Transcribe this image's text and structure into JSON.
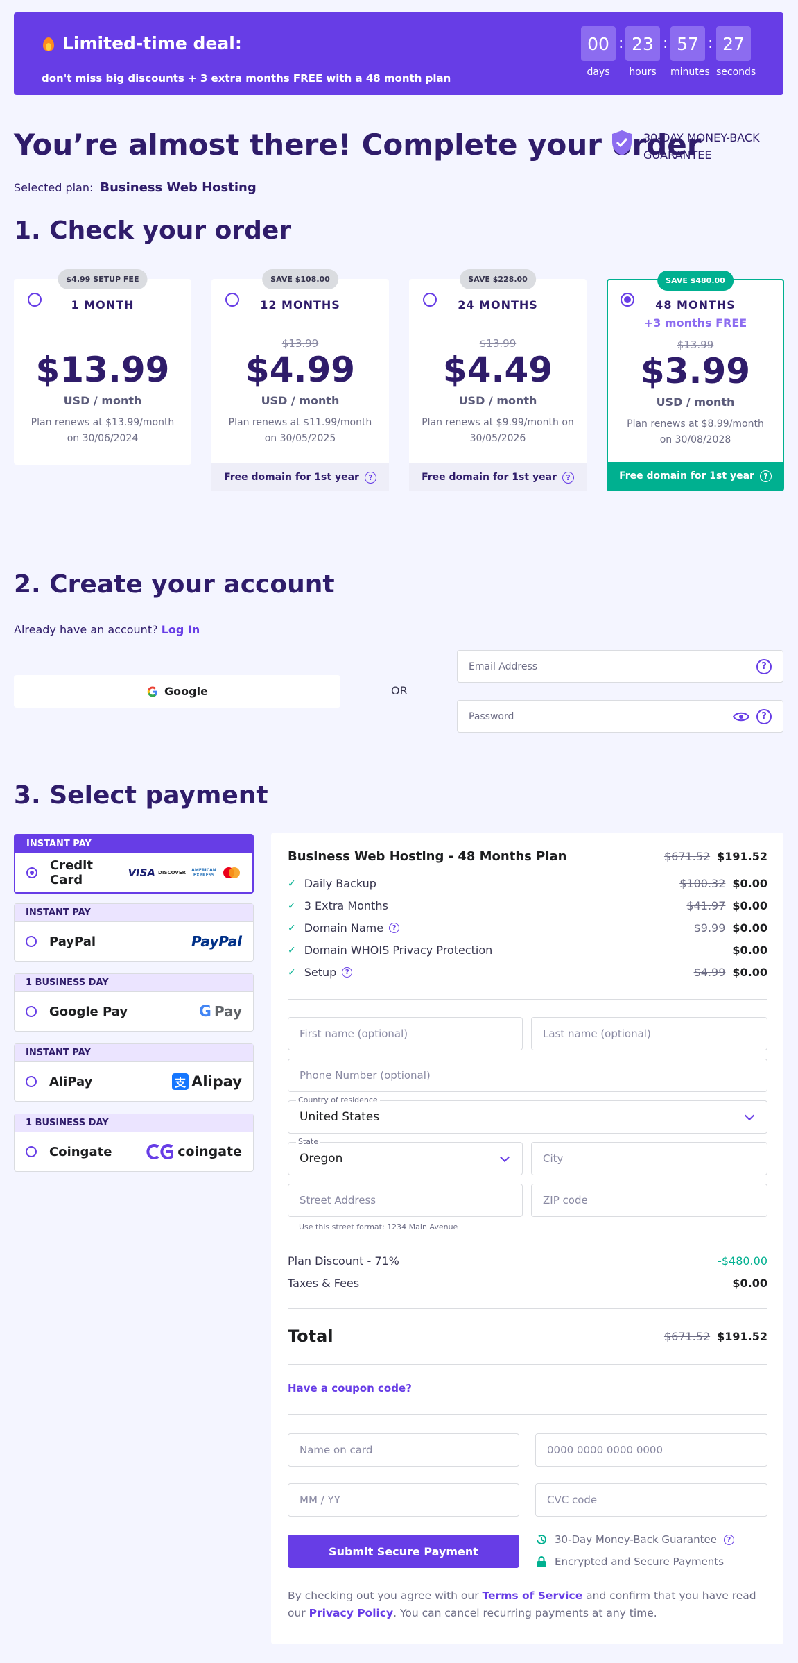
{
  "banner": {
    "title": "Limited-time deal:",
    "subtitle": "don't miss big discounts + 3 extra months FREE with a 48 month plan",
    "countdown": [
      {
        "value": "00",
        "label": "days"
      },
      {
        "value": "23",
        "label": "hours"
      },
      {
        "value": "57",
        "label": "minutes"
      },
      {
        "value": "27",
        "label": "seconds"
      }
    ]
  },
  "header": {
    "title": "You’re almost there! Complete your order",
    "guarantee_line1": "30-DAY MONEY-BACK",
    "guarantee_line2": "GUARANTEE",
    "selected_plan_label": "Selected plan:",
    "selected_plan_value": "Business Web Hosting"
  },
  "section1": {
    "title": "1. Check your order",
    "plans": [
      {
        "badge": "$4.99 SETUP FEE",
        "name": "1 MONTH",
        "old_price": "",
        "price": "$13.99",
        "unit": "USD / month",
        "renew": "Plan renews at $13.99/month on 30/06/2024",
        "footer": ""
      },
      {
        "badge": "SAVE $108.00",
        "name": "12 MONTHS",
        "old_price": "$13.99",
        "price": "$4.99",
        "unit": "USD / month",
        "renew": "Plan renews at $11.99/month on 30/05/2025",
        "footer": "Free domain for 1st year"
      },
      {
        "badge": "SAVE $228.00",
        "name": "24 MONTHS",
        "old_price": "$13.99",
        "price": "$4.49",
        "unit": "USD / month",
        "renew": "Plan renews at $9.99/month on 30/05/2026",
        "footer": "Free domain for 1st year"
      },
      {
        "badge": "SAVE $480.00",
        "name": "48 MONTHS",
        "extra": "+3 months FREE",
        "old_price": "$13.99",
        "price": "$3.99",
        "unit": "USD / month",
        "renew": "Plan renews at $8.99/month on 30/08/2028",
        "footer": "Free domain for 1st year"
      }
    ]
  },
  "section2": {
    "title": "2. Create your account",
    "have_account": "Already have an account?",
    "login_link": "Log In",
    "google_label": "Google",
    "or_label": "OR",
    "email_placeholder": "Email Address",
    "password_placeholder": "Password"
  },
  "section3": {
    "title": "3. Select payment",
    "methods": [
      {
        "tag": "INSTANT PAY",
        "name": "Credit Card"
      },
      {
        "tag": "INSTANT PAY",
        "name": "PayPal"
      },
      {
        "tag": "1 BUSINESS DAY",
        "name": "Google Pay"
      },
      {
        "tag": "INSTANT PAY",
        "name": "AliPay"
      },
      {
        "tag": "1 BUSINESS DAY",
        "name": "Coingate"
      }
    ],
    "card_logos": {
      "visa": "VISA",
      "discover": "DISCOVER",
      "amex": "AMERICAN EXPRESS"
    },
    "paypal_logo": "PayPal",
    "gpay_logo": "Pay",
    "alipay_logo": "Alipay",
    "coingate_logo": "coingate"
  },
  "summary": {
    "plan_title": "Business Web Hosting - 48 Months Plan",
    "plan_old": "$671.52",
    "plan_new": "$191.52",
    "items": [
      {
        "label": "Daily Backup",
        "old": "$100.32",
        "new": "$0.00",
        "help": false
      },
      {
        "label": "3 Extra Months",
        "old": "$41.97",
        "new": "$0.00",
        "help": false
      },
      {
        "label": "Domain Name",
        "old": "$9.99",
        "new": "$0.00",
        "help": true
      },
      {
        "label": "Domain WHOIS Privacy Protection",
        "old": "",
        "new": "$0.00",
        "help": false
      },
      {
        "label": "Setup",
        "old": "$4.99",
        "new": "$0.00",
        "help": true
      }
    ],
    "form": {
      "first_name": "First name (optional)",
      "last_name": "Last name (optional)",
      "phone": "Phone Number (optional)",
      "country_label": "Country of residence",
      "country_value": "United States",
      "state_label": "State",
      "state_value": "Oregon",
      "city": "City",
      "street": "Street Address",
      "zip": "ZIP code",
      "street_hint": "Use this street format: 1234 Main Avenue"
    },
    "discount_label": "Plan Discount - 71%",
    "discount_value": "-$480.00",
    "taxes_label": "Taxes & Fees",
    "taxes_value": "$0.00",
    "total_label": "Total",
    "total_old": "$671.52",
    "total_new": "$191.52",
    "coupon": "Have a coupon code?",
    "card": {
      "name": "Name on card",
      "number": "0000 0000 0000 0000",
      "expiry": "MM / YY",
      "cvc": "CVC code"
    },
    "submit": "Submit Secure Payment",
    "guarantee": "30-Day Money-Back Guarantee",
    "secure": "Encrypted and Secure Payments",
    "terms_pre": "By checking out you agree with our",
    "terms_link": "Terms of Service",
    "terms_mid": "and confirm that you have read our",
    "privacy_link": "Privacy Policy",
    "terms_post": ". You can cancel recurring payments at any time."
  },
  "colors": {
    "primary": "#673de6",
    "dark": "#2f1c6a",
    "success": "#00b090",
    "background": "#f4f5ff"
  }
}
